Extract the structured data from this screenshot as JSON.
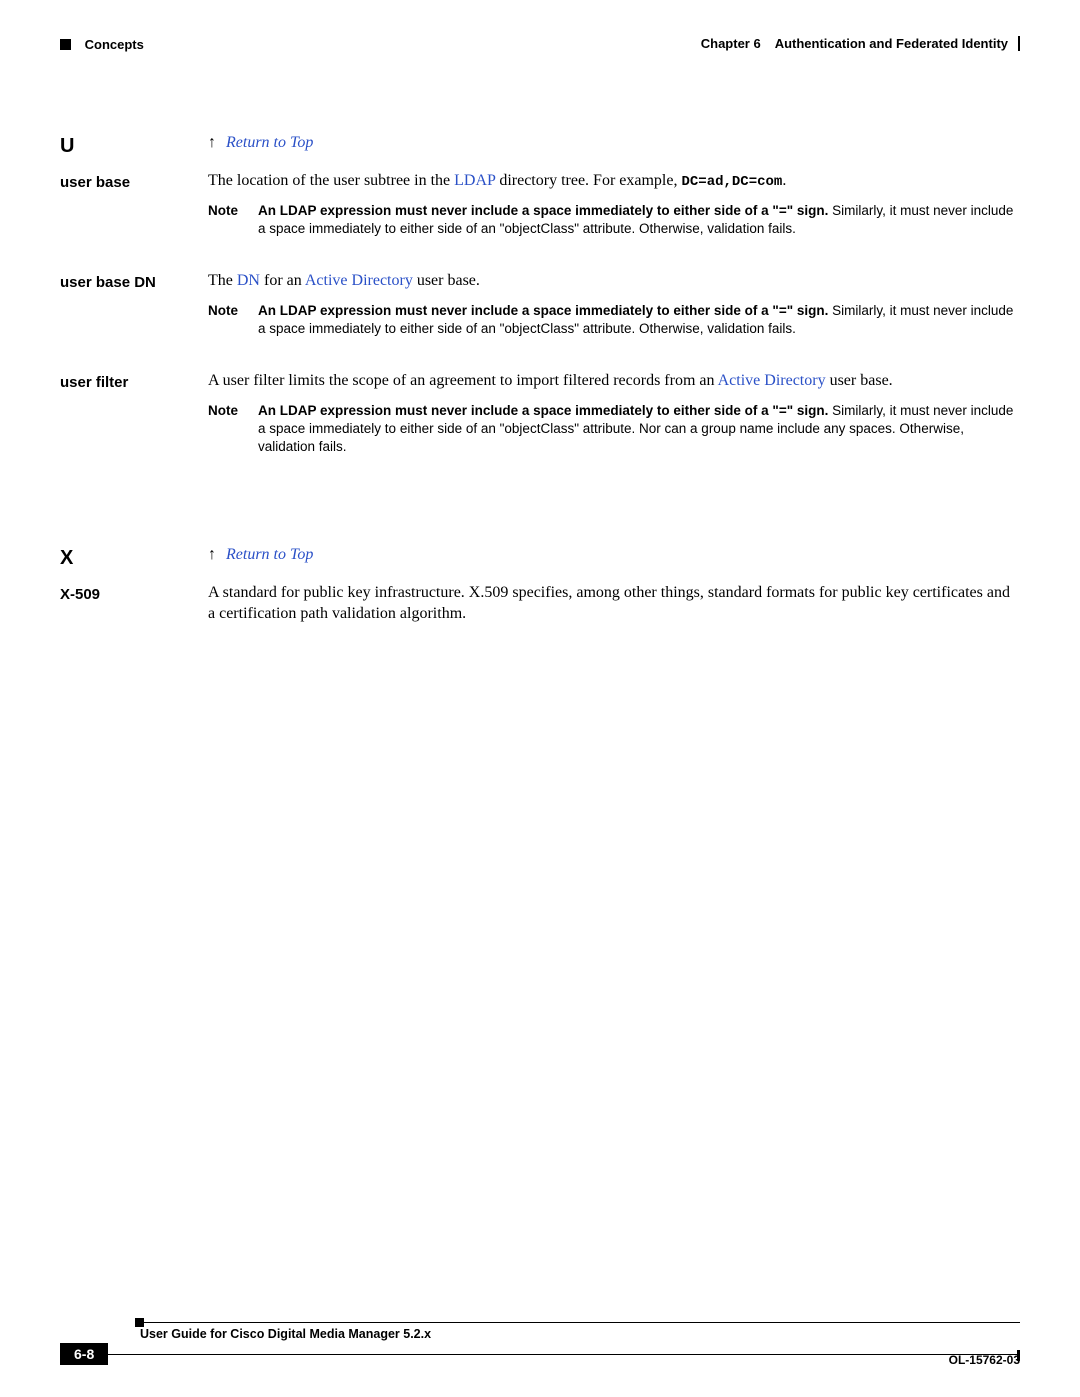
{
  "header": {
    "section_title": "Concepts",
    "chapter_prefix": "Chapter 6",
    "chapter_title": "Authentication and Federated Identity"
  },
  "letters": {
    "U": "U",
    "X": "X"
  },
  "return_to_top": "Return to Top",
  "terms": {
    "user_base": {
      "label": "user base",
      "def_pre": "The location of the user subtree in the ",
      "def_link": "LDAP",
      "def_post": " directory tree. For example, ",
      "def_code": "DC=ad,DC=com",
      "def_end": "."
    },
    "user_base_dn": {
      "label": "user base DN",
      "def_pre": "The ",
      "def_link1": "DN",
      "def_mid": " for an ",
      "def_link2": "Active Directory",
      "def_post": " user base."
    },
    "user_filter": {
      "label": "user filter",
      "def_pre": "A user filter limits the scope of an agreement to import filtered records from an ",
      "def_link": "Active Directory",
      "def_post": " user base."
    },
    "x509": {
      "label": "X-509",
      "def": "A standard for public key infrastructure. X.509 specifies, among other things, standard formats for public key certificates and a certification path validation algorithm."
    }
  },
  "notes": {
    "label": "Note",
    "std_bold": "An LDAP expression must never include a space immediately to either side of a \"=\" sign.",
    "std_rest": " Similarly, it must never include a space immediately to either side of an \"objectClass\" attribute. Otherwise, validation fails.",
    "filter_rest": " Similarly, it must never include a space immediately to either side of an \"objectClass\" attribute. Nor can a group name include any spaces. Otherwise, validation fails."
  },
  "footer": {
    "guide_title": "User Guide for Cisco Digital Media Manager 5.2.x",
    "page_number": "6-8",
    "doc_id": "OL-15762-03"
  }
}
